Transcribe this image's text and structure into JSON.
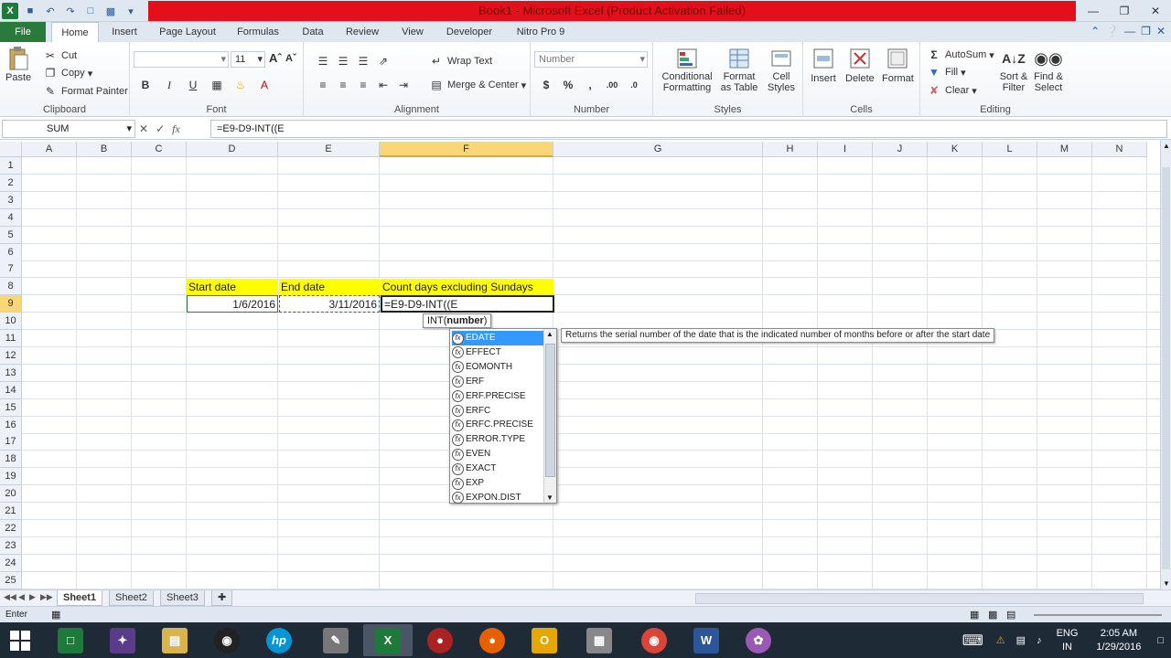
{
  "window": {
    "title": "Book1 - Microsoft Excel (Product Activation Failed)"
  },
  "tabs": [
    {
      "label": "File"
    },
    {
      "label": "Home"
    },
    {
      "label": "Insert"
    },
    {
      "label": "Page Layout"
    },
    {
      "label": "Formulas"
    },
    {
      "label": "Data"
    },
    {
      "label": "Review"
    },
    {
      "label": "View"
    },
    {
      "label": "Developer"
    },
    {
      "label": "Nitro Pro 9"
    }
  ],
  "ribbon": {
    "clipboard": {
      "label": "Clipboard",
      "paste": "Paste",
      "cut": "Cut",
      "copy": "Copy",
      "format_painter": "Format Painter"
    },
    "font": {
      "label": "Font",
      "font_size": "11"
    },
    "alignment": {
      "label": "Alignment",
      "wrap": "Wrap Text",
      "merge": "Merge & Center"
    },
    "number": {
      "label": "Number",
      "format": "Number"
    },
    "styles": {
      "label": "Styles",
      "cond": "Conditional Formatting",
      "table": "Format as Table",
      "cell": "Cell Styles"
    },
    "cells": {
      "label": "Cells",
      "insert": "Insert",
      "delete": "Delete",
      "format": "Format"
    },
    "editing": {
      "label": "Editing",
      "autosum": "AutoSum",
      "fill": "Fill",
      "clear": "Clear",
      "sort": "Sort & Filter",
      "find": "Find & Select"
    }
  },
  "formula_bar": {
    "name_box": "SUM",
    "formula": "=E9-D9-INT((E"
  },
  "columns": [
    "A",
    "B",
    "C",
    "D",
    "E",
    "F",
    "G",
    "H",
    "I",
    "J",
    "K",
    "L",
    "M",
    "N"
  ],
  "rows": [
    "1",
    "2",
    "3",
    "4",
    "5",
    "6",
    "7",
    "8",
    "9",
    "10",
    "11",
    "12",
    "13",
    "14",
    "15",
    "16",
    "17",
    "18",
    "19",
    "20",
    "21",
    "22",
    "23",
    "24",
    "25"
  ],
  "cells": {
    "D8": "Start date",
    "E8": "End date",
    "F8": "Count days excluding Sundays",
    "D9": "1/6/2016",
    "E9": "3/11/2016",
    "F9": "=E9-D9-INT((E"
  },
  "autocomplete": {
    "hint_fn": "INT(",
    "hint_arg": "number",
    "hint_close": ")",
    "items": [
      "EDATE",
      "EFFECT",
      "EOMONTH",
      "ERF",
      "ERF.PRECISE",
      "ERFC",
      "ERFC.PRECISE",
      "ERROR.TYPE",
      "EVEN",
      "EXACT",
      "EXP",
      "EXPON.DIST"
    ],
    "description": "Returns the serial number of the date that is the indicated number of months before or after the start date"
  },
  "sheets": [
    "Sheet1",
    "Sheet2",
    "Sheet3"
  ],
  "status": {
    "mode": "Enter"
  },
  "taskbar": {
    "lang": "ENG",
    "region": "IN",
    "time": "2:05 AM",
    "date": "1/29/2016"
  },
  "colors": {
    "title_bar": "#e3101b",
    "file_tab": "#2a7a3c",
    "highlight": "#ffff00",
    "selection": "#3399ff"
  }
}
